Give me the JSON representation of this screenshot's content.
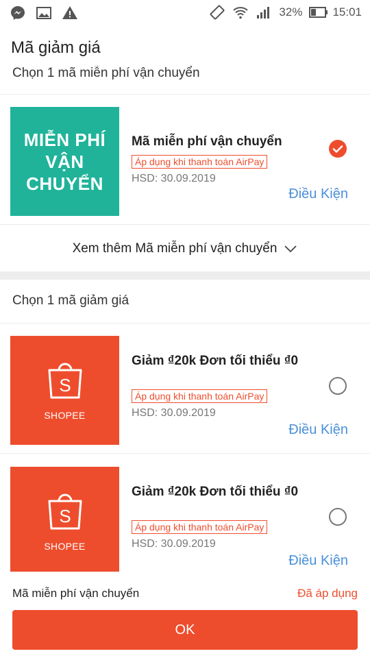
{
  "status_bar": {
    "left_icons": [
      "messenger-icon",
      "image-icon",
      "warning-icon"
    ],
    "battery_percent": "32%",
    "time": "15:01"
  },
  "header": {
    "title": "Mã giảm giá"
  },
  "shipping_section": {
    "heading": "Chọn 1 mã miễn phí vận chuyển",
    "voucher": {
      "thumb_text": "MIỄN PHÍ VẬN CHUYỂN",
      "thumb_color": "#20b39a",
      "title": "Mã miễn phí vận chuyển",
      "tag": "Áp dụng khi thanh toán AirPay",
      "expiry": "HSD: 30.09.2019",
      "terms": "Điều Kiện",
      "selected": true
    },
    "see_more": "Xem thêm Mã miễn phí vận chuyển"
  },
  "discount_section": {
    "heading": "Chọn 1 mã giảm giá",
    "vouchers": [
      {
        "thumb_caption": "SHOPEE",
        "title": "Giảm ₫20k Đơn tối thiểu ₫0",
        "tag": "Áp dụng khi thanh toán AirPay",
        "expiry": "HSD: 30.09.2019",
        "terms": "Điều Kiện",
        "selected": false
      },
      {
        "thumb_caption": "SHOPEE",
        "title": "Giảm ₫20k Đơn tối thiểu ₫0",
        "tag": "Áp dụng khi thanh toán AirPay",
        "expiry": "HSD: 30.09.2019",
        "terms": "Điều Kiện",
        "selected": false
      }
    ]
  },
  "footer": {
    "label": "Mã miễn phí vận chuyển",
    "status": "Đã áp dụng",
    "ok_label": "OK"
  },
  "colors": {
    "accent": "#ee4d2d",
    "link": "#4a90d9",
    "teal": "#20b39a"
  }
}
